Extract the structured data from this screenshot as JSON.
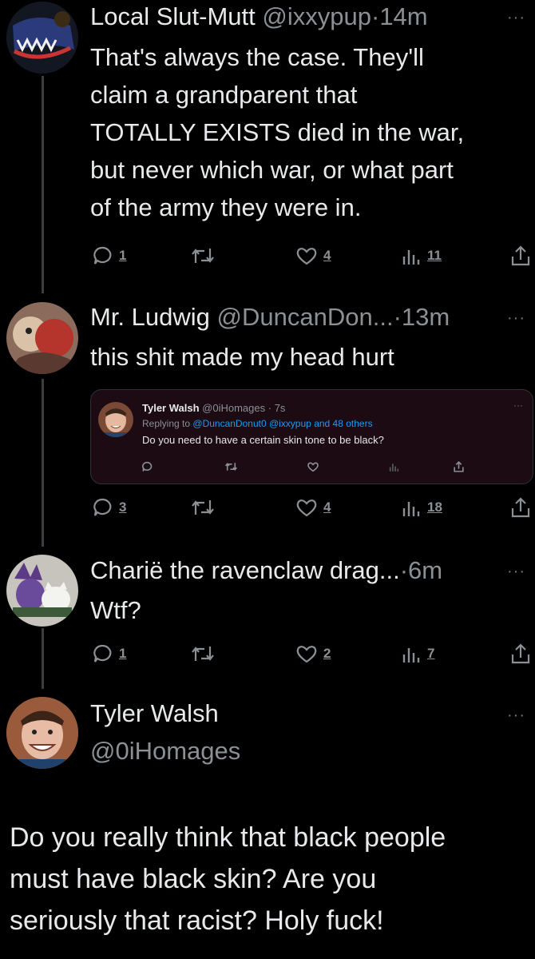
{
  "tweets": [
    {
      "name": "Local Slut-Mutt",
      "handle": "@ixxypup",
      "time": "14m",
      "lines": [
        "That's always the case. They'll",
        "claim a grandparent that",
        "TOTALLY EXISTS died in the war,",
        "but never which war, or what part",
        "of the army they were in."
      ],
      "replies": "1",
      "likes": "4",
      "views": "11"
    },
    {
      "name": "Mr. Ludwig",
      "handle": "@DuncanDon...",
      "time": "13m",
      "lines": [
        "this shit made my head hurt"
      ],
      "replies": "3",
      "likes": "4",
      "views": "18"
    },
    {
      "name": "Charië the ravenclaw drag...",
      "handle": "",
      "time": "6m",
      "lines": [
        "Wtf?"
      ],
      "replies": "1",
      "likes": "2",
      "views": "7"
    }
  ],
  "quoted": {
    "name": "Tyler Walsh",
    "handle": "@0iHomages",
    "time": "7s",
    "replying_prefix": "Replying to",
    "replying_links": "@DuncanDonut0 @ixxypup",
    "replying_suffix": "and 48 others",
    "text": "Do you need to have a certain skin tone to be black?"
  },
  "main_tweet": {
    "name": "Tyler Walsh",
    "handle": "@0iHomages",
    "lines": [
      "Do you really think that black people",
      "must have black skin? Are you",
      "seriously that racist? Holy fuck!"
    ]
  },
  "separator": "·",
  "more_glyph": "···",
  "colors": {
    "background": "#000000",
    "text": "#e7e9ea",
    "muted": "#8b9095",
    "link": "#1d9bf0",
    "quote_bg": "#1c0b12"
  },
  "icons": [
    "reply-icon",
    "retweet-icon",
    "like-icon",
    "views-icon",
    "share-icon"
  ]
}
